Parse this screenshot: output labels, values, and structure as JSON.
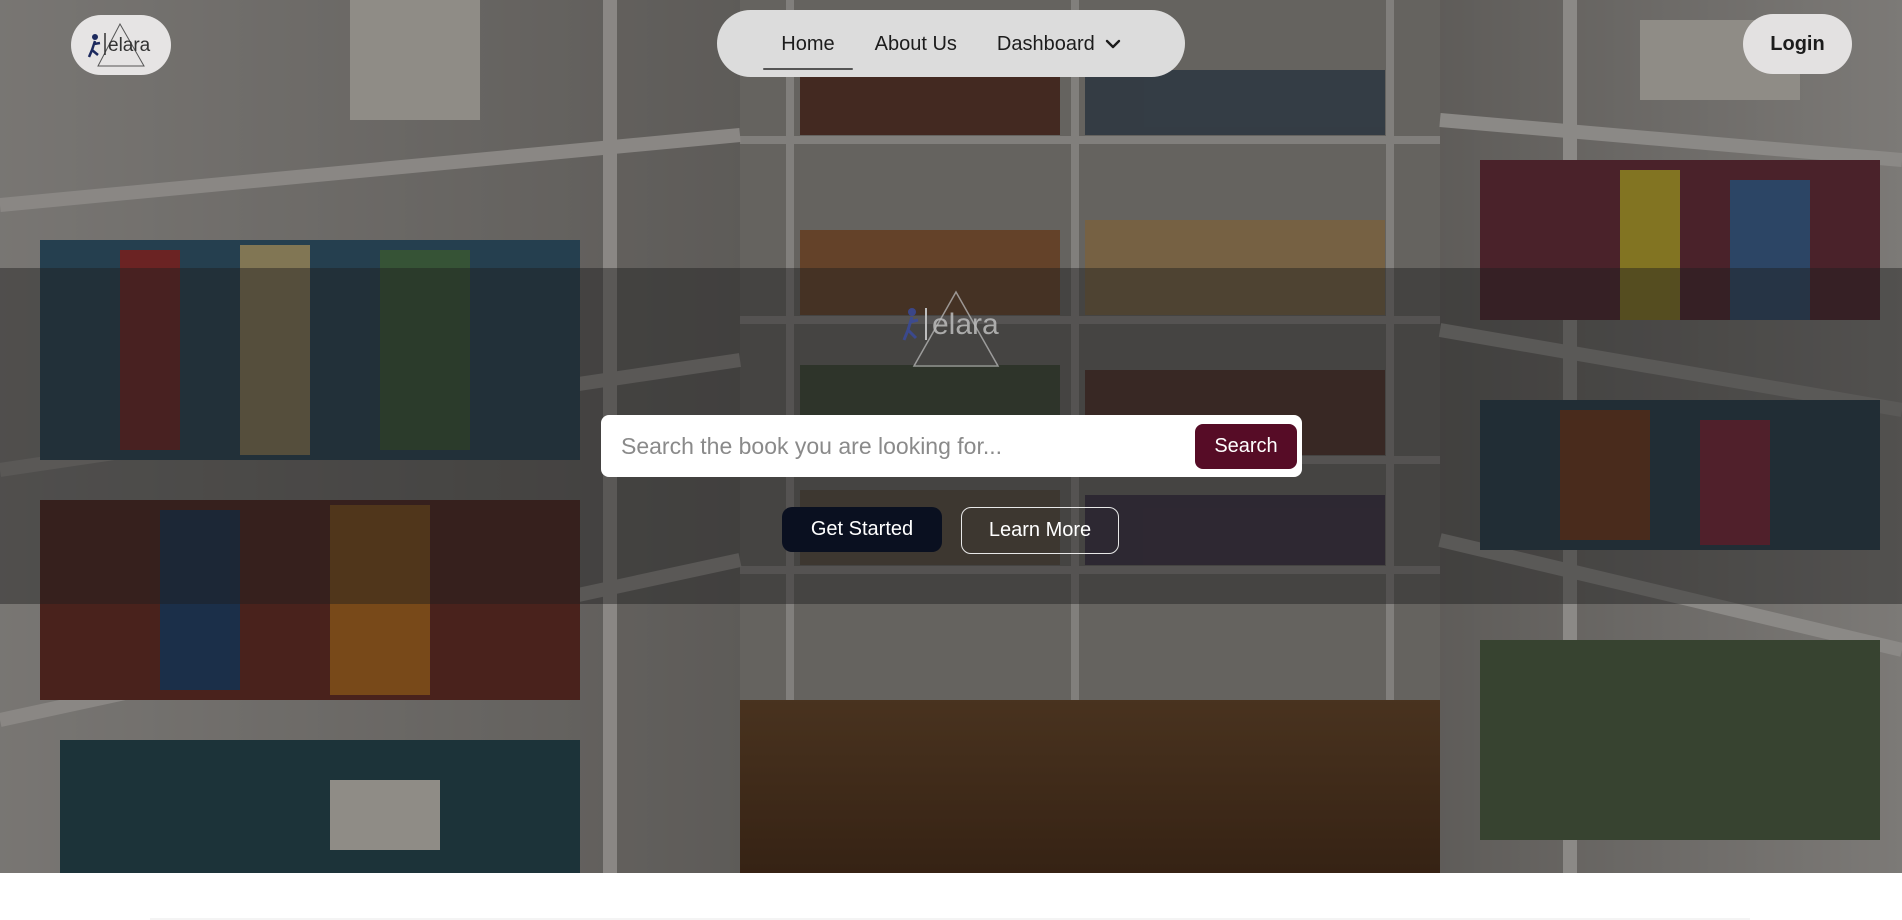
{
  "brand": {
    "logo_text": "elara",
    "logo_icon": "walking-person-logo-icon"
  },
  "nav": {
    "items": [
      {
        "label": "Home",
        "active": true
      },
      {
        "label": "About Us",
        "active": false
      },
      {
        "label": "Dashboard",
        "active": false,
        "icon": "chevron-down-icon"
      }
    ]
  },
  "header": {
    "login_label": "Login"
  },
  "hero": {
    "background": "library-bookshelves-photo",
    "search": {
      "placeholder": "Search the book you are looking for...",
      "value": "",
      "button_label": "Search"
    },
    "primary_cta": "Get Started",
    "secondary_cta": "Learn More"
  },
  "colors": {
    "accent": "#560c26",
    "dark_button": "#0a1020",
    "pill_bg": "#dcdcdc"
  }
}
